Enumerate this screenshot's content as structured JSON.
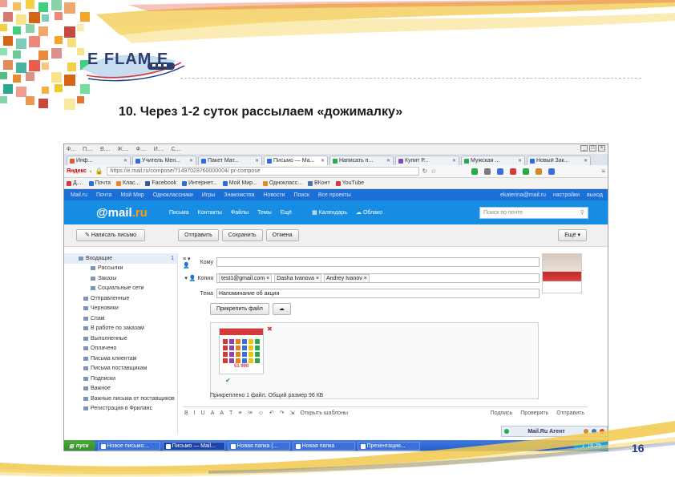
{
  "slide": {
    "logo_text": "E FLAM E",
    "title": "10. Через 1-2 суток  рассылаем «дожималку»",
    "page_number": "16"
  },
  "browser": {
    "menu": [
      "Ф...",
      "П....",
      "В....",
      "Ж....",
      "Ф....",
      "И....",
      "С...."
    ],
    "tabs": [
      {
        "label": "Инф...",
        "color": "#e05a2b",
        "active": false
      },
      {
        "label": "Учитель Мен...",
        "color": "#2b6de0",
        "active": false
      },
      {
        "label": "Пакет Мат...",
        "color": "#2b6de0",
        "active": false
      },
      {
        "label": "Письмо — Ма...",
        "color": "#2b6de0",
        "active": true
      },
      {
        "label": "Написать п...",
        "color": "#2ba84a",
        "active": false
      },
      {
        "label": "Купит Р...",
        "color": "#7a4ab8",
        "active": false
      },
      {
        "label": "Мужская ...",
        "color": "#2ba84a",
        "active": false
      },
      {
        "label": "Новый Зак...",
        "color": "#2b6de0",
        "active": false
      }
    ],
    "brand": "Яндекс",
    "url": "https://e.mail.ru/compose/?1497028760000004/ pr-compose",
    "extensions": [
      "#2ba84a",
      "#7a7a7a",
      "#3a6fd8",
      "#d43a3a",
      "#2ba84a",
      "#d48a2a",
      "#3a6fd8"
    ],
    "bookmarks": [
      {
        "label": "Д....",
        "color": "#d43a3a"
      },
      {
        "label": "Почта",
        "color": "#2b6de0"
      },
      {
        "label": "Клас...",
        "color": "#e08a2b"
      },
      {
        "label": "Facebook",
        "color": "#3b5998"
      },
      {
        "label": "Интернет...",
        "color": "#2b6de0"
      },
      {
        "label": "Мой Мир...",
        "color": "#2b6de0"
      },
      {
        "label": "Однокласс...",
        "color": "#e08a2b"
      },
      {
        "label": "ВКонт",
        "color": "#4a76a8"
      },
      {
        "label": "YouTube",
        "color": "#d43a3a"
      }
    ]
  },
  "portal": {
    "links": [
      "Mail.ru",
      "Почта",
      "Мой Мир",
      "Одноклассники",
      "Игры",
      "Знакомства",
      "Новости",
      "Поиск",
      "Все проекты"
    ],
    "right": [
      "ekaterina@mail.ru",
      "настройки",
      "выход"
    ]
  },
  "mail": {
    "logo_main": "mail",
    "logo_suffix": ".ru",
    "nav": [
      "Письма",
      "Контакты",
      "Файлы",
      "Темы",
      "Ещё"
    ],
    "calendar": "Календарь",
    "cloud": "Облако",
    "search_placeholder": "Поиск по почте"
  },
  "toolbar": {
    "new_letter": "Написать письмо",
    "send": "Отправить",
    "save": "Сохранить",
    "cancel": "Отмена",
    "more": "Ещё"
  },
  "folders": [
    {
      "label": "Входящие",
      "count": "1",
      "selected": true
    },
    {
      "label": "Рассылки",
      "count": "",
      "selected": false
    },
    {
      "label": "Заказы",
      "count": "",
      "selected": false
    },
    {
      "label": "Социальные сети",
      "count": "",
      "selected": false
    },
    {
      "label": "Отправленные",
      "count": "",
      "selected": false
    },
    {
      "label": "Черновики",
      "count": "",
      "selected": false
    },
    {
      "label": "Спам",
      "count": "",
      "selected": false
    },
    {
      "label": "В работе по заказам",
      "count": "",
      "selected": false
    },
    {
      "label": "Выполненные",
      "count": "",
      "selected": false
    },
    {
      "label": "Оплачено",
      "count": "",
      "selected": false
    },
    {
      "label": "Письма клиентам",
      "count": "",
      "selected": false
    },
    {
      "label": "Письма поставщикам",
      "count": "",
      "selected": false
    },
    {
      "label": "Подписки",
      "count": "",
      "selected": false
    },
    {
      "label": "Важное",
      "count": "",
      "selected": false
    },
    {
      "label": "Важные письма от поставщиков",
      "count": "",
      "selected": false
    },
    {
      "label": "Регистрация в Фриланс",
      "count": "",
      "selected": false
    }
  ],
  "compose": {
    "to_label": "Кому",
    "cc_label": "Копия",
    "cc_chips": [
      "test1@gmail.com",
      "Dasha Ivanova",
      "Andrey Ivanov"
    ],
    "subject_label": "Тема",
    "subject_value": "Напоминание об акции",
    "attach_button": "Прикрепить файл",
    "thumb_price": "51 990",
    "summary": "Прикреплено 1 файл. Общий размер 96 КБ"
  },
  "format": {
    "items": [
      "B",
      "I",
      "U",
      "A",
      "A",
      "Т",
      "≡",
      "⁝≡",
      "☺",
      "↶",
      "↷",
      "⇲"
    ],
    "text": "Открыть шаблоны",
    "right": [
      "Подпись",
      "Проверить",
      "Отправить"
    ]
  },
  "agent": {
    "label": "Mail.Ru Агент"
  },
  "taskbar": {
    "start": "пуск",
    "tasks": [
      {
        "label": "Новое письмо...",
        "active": false
      },
      {
        "label": "Письмо — Mail...",
        "active": true
      },
      {
        "label": "Новая папка (...",
        "active": false
      },
      {
        "label": "Новая папка",
        "active": false
      },
      {
        "label": "Презентация...",
        "active": false
      }
    ],
    "clock": "16:25"
  }
}
